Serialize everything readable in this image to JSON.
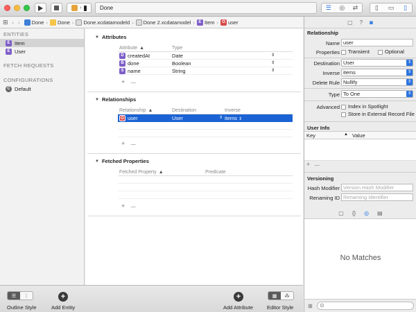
{
  "toolbar": {
    "run_icon": "play-icon",
    "stop_icon": "stop-icon",
    "scheme_icon": "scheme-icon",
    "status": "Done"
  },
  "jumpbar": {
    "items": [
      "Done",
      "Done",
      "Done.xcdatamodeld",
      "Done 2.xcdatamodel",
      "Item",
      "user"
    ],
    "entity_badge": "E",
    "relationship_badge": "O"
  },
  "sidebar": {
    "entities_heading": "ENTITIES",
    "entities": [
      {
        "label": "Item",
        "badge": "E",
        "selected": true
      },
      {
        "label": "User",
        "badge": "E",
        "selected": false
      }
    ],
    "fetch_requests_heading": "FETCH REQUESTS",
    "configurations_heading": "CONFIGURATIONS",
    "configurations": [
      {
        "label": "Default",
        "badge": "C"
      }
    ]
  },
  "editor": {
    "attributes": {
      "title": "Attributes",
      "columns": [
        "Attribute",
        "Type"
      ],
      "rows": [
        {
          "badge": "D",
          "name": "createdAt",
          "type": "Date"
        },
        {
          "badge": "B",
          "name": "done",
          "type": "Boolean"
        },
        {
          "badge": "S",
          "name": "name",
          "type": "String"
        }
      ]
    },
    "relationships": {
      "title": "Relationships",
      "columns": [
        "Relationship",
        "Destination",
        "Inverse"
      ],
      "rows": [
        {
          "badge": "O",
          "name": "user",
          "destination": "User",
          "inverse": "items"
        }
      ]
    },
    "fetched_properties": {
      "title": "Fetched Properties",
      "columns": [
        "Fetched Property",
        "Predicate"
      ]
    },
    "add_symbol": "+",
    "remove_symbol": "—"
  },
  "bottombar": {
    "outline_style": "Outline Style",
    "add_entity": "Add Entity",
    "add_attribute": "Add Attribute",
    "editor_style": "Editor Style"
  },
  "inspector": {
    "section_title": "Relationship",
    "name_label": "Name",
    "name_value": "user",
    "properties_label": "Properties",
    "transient_label": "Transient",
    "optional_label": "Optional",
    "destination_label": "Destination",
    "destination_value": "User",
    "inverse_label": "Inverse",
    "inverse_value": "items",
    "delete_rule_label": "Delete Rule",
    "delete_rule_value": "Nullify",
    "type_label": "Type",
    "type_value": "To One",
    "advanced_label": "Advanced",
    "index_spotlight_label": "Index in Spotlight",
    "external_record_label": "Store in External Record File",
    "user_info_title": "User Info",
    "key_col": "Key",
    "value_col": "Value",
    "versioning_title": "Versioning",
    "hash_modifier_label": "Hash Modifier",
    "hash_modifier_placeholder": "Version Hash Modifier",
    "renaming_id_label": "Renaming ID",
    "renaming_id_placeholder": "Renaming Identifier",
    "no_matches": "No Matches"
  },
  "colors": {
    "selection": "#1b63d4",
    "accent": "#2d74e0"
  }
}
